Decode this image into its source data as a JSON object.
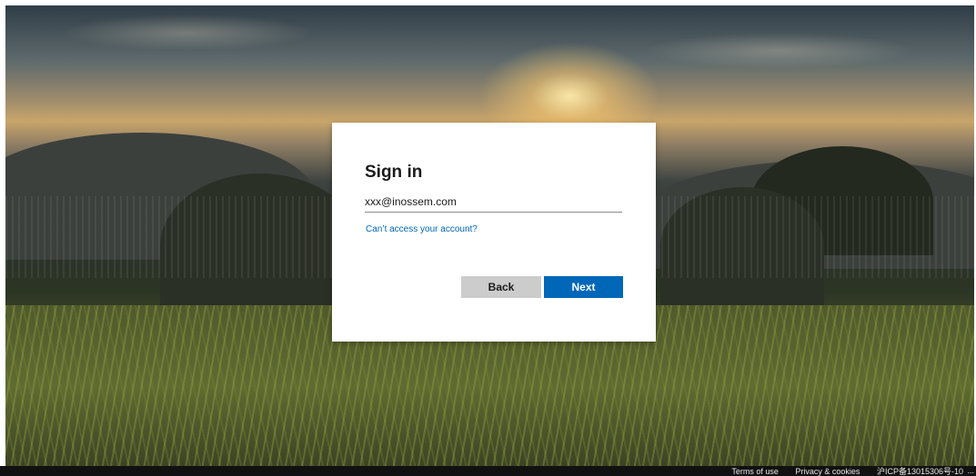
{
  "signin": {
    "title": "Sign in",
    "email_value": "xxx@inossem.com",
    "cant_access_link": "Can’t access your account?",
    "back_label": "Back",
    "next_label": "Next"
  },
  "footer": {
    "terms": "Terms of use",
    "privacy": "Privacy & cookies",
    "icp": "沪ICP备13015306号-10",
    "more": "..."
  },
  "colors": {
    "accent": "#0067b8",
    "back_button": "#cccccc",
    "dialog_bg": "#ffffff",
    "footer_bg": "#111111"
  },
  "icons": [
    "more-options-icon"
  ]
}
